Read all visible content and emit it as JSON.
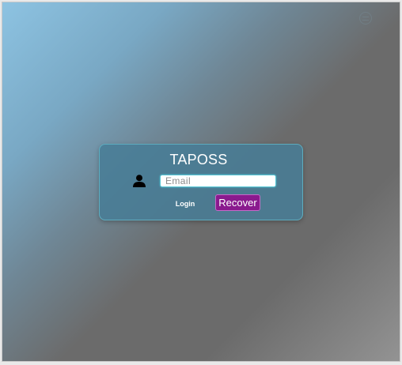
{
  "app": {
    "title": "TAPOSS"
  },
  "login_form": {
    "email_placeholder": "Email",
    "email_value": "",
    "login_label": "Login",
    "recover_label": "Recover"
  },
  "icons": {
    "user": "user-icon",
    "corner": "settings-icon"
  },
  "colors": {
    "card_background": "#467d96",
    "card_border": "#64bec d",
    "recover_button": "#8a1a8e",
    "input_border": "#56c6d6"
  }
}
